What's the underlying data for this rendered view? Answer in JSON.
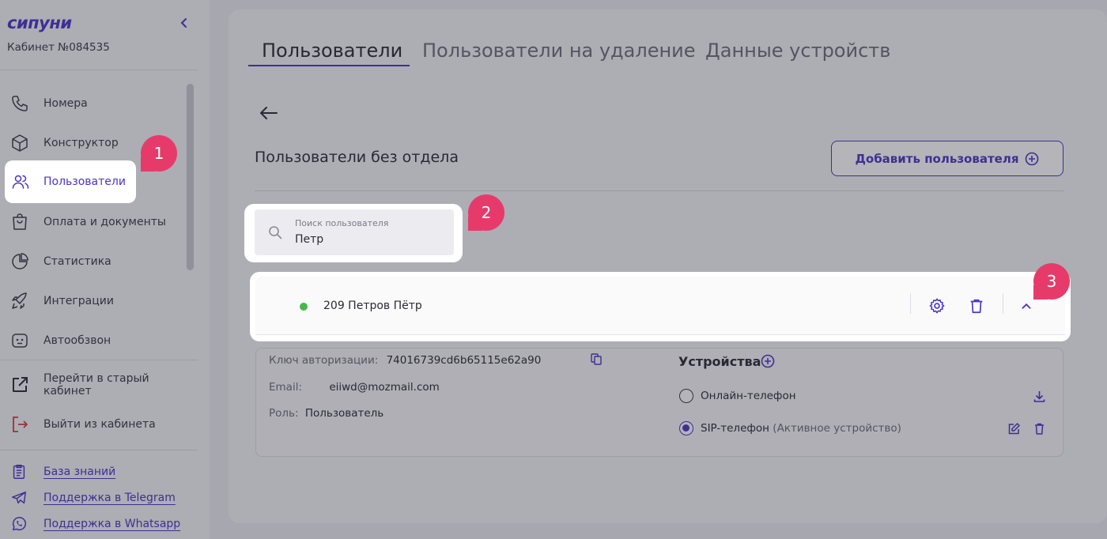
{
  "sidebar": {
    "logo": "сипуни",
    "cabinet": "Кабинет №084535",
    "nav": [
      {
        "label": "Номера",
        "icon": "phone-icon"
      },
      {
        "label": "Конструктор",
        "icon": "cube-icon"
      },
      {
        "label": "Пользователи",
        "icon": "users-icon",
        "active": true
      },
      {
        "label": "Оплата и документы",
        "icon": "bag-icon"
      },
      {
        "label": "Статистика",
        "icon": "pie-chart-icon"
      },
      {
        "label": "Интеграции",
        "icon": "rocket-icon"
      },
      {
        "label": "Автообзвон",
        "icon": "robot-icon"
      }
    ],
    "actions": [
      {
        "label": "Перейти в старый кабинет",
        "icon": "external-link-icon"
      },
      {
        "label": "Выйти из кабинета",
        "icon": "logout-icon"
      }
    ],
    "links": [
      {
        "label": "База знаний",
        "icon": "clipboard-icon"
      },
      {
        "label": "Поддержка в Telegram",
        "icon": "telegram-icon"
      },
      {
        "label": "Поддержка в Whatsapp",
        "icon": "whatsapp-icon"
      }
    ]
  },
  "tabs": [
    {
      "label": "Пользователи",
      "active": true
    },
    {
      "label": "Пользователи на удаление"
    },
    {
      "label": "Данные устройств"
    }
  ],
  "section_title": "Пользователи без отдела",
  "add_button": "Добавить пользователя",
  "search": {
    "placeholder": "Поиск пользователя",
    "value": "Петр"
  },
  "user": {
    "name": "209 Петров Пётр",
    "status_color": "#46b84a",
    "auth_key_label": "Ключ авторизации:",
    "auth_key": "74016739cd6b65115e62a90",
    "email_label": "Email:",
    "email": "eiiwd@mozmail.com",
    "role_label": "Роль:",
    "role": "Пользователь"
  },
  "devices": {
    "title": "Устройства",
    "items": [
      {
        "label": "Онлайн-телефон",
        "note": "",
        "selected": false
      },
      {
        "label": "SIP-телефон",
        "note": "(Активное устройство)",
        "selected": true
      }
    ]
  },
  "badges": [
    "1",
    "2",
    "3"
  ],
  "colors": {
    "accent": "#4a33c6",
    "badge": "#e63b6a",
    "status": "#46b84a"
  }
}
